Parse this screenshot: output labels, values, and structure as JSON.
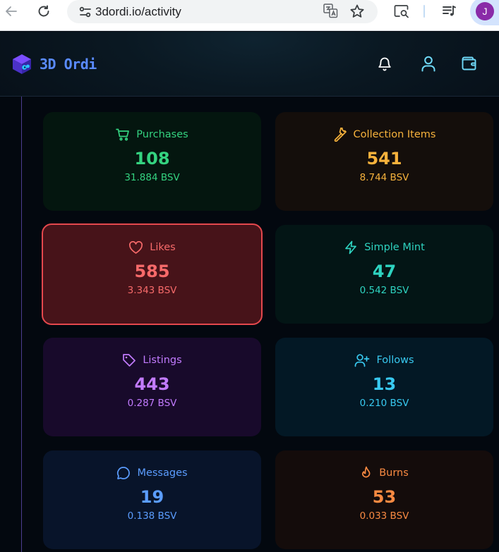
{
  "browser": {
    "url": "3dordi.io/activity",
    "profile_initial": "J"
  },
  "app": {
    "title": "3D Ordi",
    "accent": "#5a8bff"
  },
  "cards": [
    {
      "label": "Purchases",
      "count": "108",
      "amount": "31.884 BSV",
      "icon": "cart-icon",
      "color": "#34d380"
    },
    {
      "label": "Collection Items",
      "count": "541",
      "amount": "8.744 BSV",
      "icon": "hammer-icon",
      "color": "#f7b23c"
    },
    {
      "label": "Likes",
      "count": "585",
      "amount": "3.343 BSV",
      "icon": "heart-icon",
      "color": "#f76a6a",
      "selected": true
    },
    {
      "label": "Simple Mint",
      "count": "47",
      "amount": "0.542 BSV",
      "icon": "lightning-icon",
      "color": "#2ed3c0"
    },
    {
      "label": "Listings",
      "count": "443",
      "amount": "0.287 BSV",
      "icon": "tag-icon",
      "color": "#c27bff"
    },
    {
      "label": "Follows",
      "count": "13",
      "amount": "0.210 BSV",
      "icon": "user-plus-icon",
      "color": "#38c9f0"
    },
    {
      "label": "Messages",
      "count": "19",
      "amount": "0.138 BSV",
      "icon": "message-circle-icon",
      "color": "#5b9dff"
    },
    {
      "label": "Burns",
      "count": "53",
      "amount": "0.033 BSV",
      "icon": "flame-icon",
      "color": "#f98a42"
    }
  ]
}
